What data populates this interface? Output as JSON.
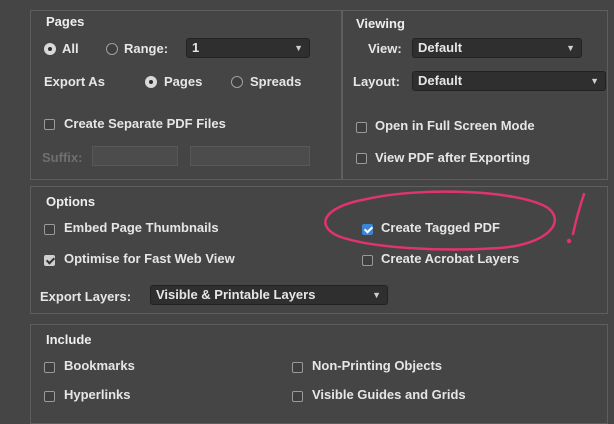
{
  "pages": {
    "title": "Pages",
    "all_label": "All",
    "range_label": "Range:",
    "range_value": "1",
    "export_as_label": "Export As",
    "pages_label": "Pages",
    "spreads_label": "Spreads",
    "separate_files_label": "Create Separate PDF Files",
    "suffix_label": "Suffix:"
  },
  "viewing": {
    "title": "Viewing",
    "view_label": "View:",
    "view_value": "Default",
    "layout_label": "Layout:",
    "layout_value": "Default",
    "full_screen_label": "Open in Full Screen Mode",
    "view_after_label": "View PDF after Exporting"
  },
  "options": {
    "title": "Options",
    "embed_thumbnails_label": "Embed Page Thumbnails",
    "tagged_pdf_label": "Create Tagged PDF",
    "fast_web_label": "Optimise for Fast Web View",
    "acrobat_layers_label": "Create Acrobat Layers",
    "export_layers_label": "Export Layers:",
    "export_layers_value": "Visible & Printable Layers"
  },
  "include": {
    "title": "Include",
    "bookmarks_label": "Bookmarks",
    "non_printing_label": "Non-Printing Objects",
    "hyperlinks_label": "Hyperlinks",
    "guides_label": "Visible Guides and Grids"
  },
  "annotation": {
    "mark": "!",
    "color": "#e0356b"
  },
  "colors": {
    "background": "#454545",
    "accent": "#3b85d6"
  }
}
